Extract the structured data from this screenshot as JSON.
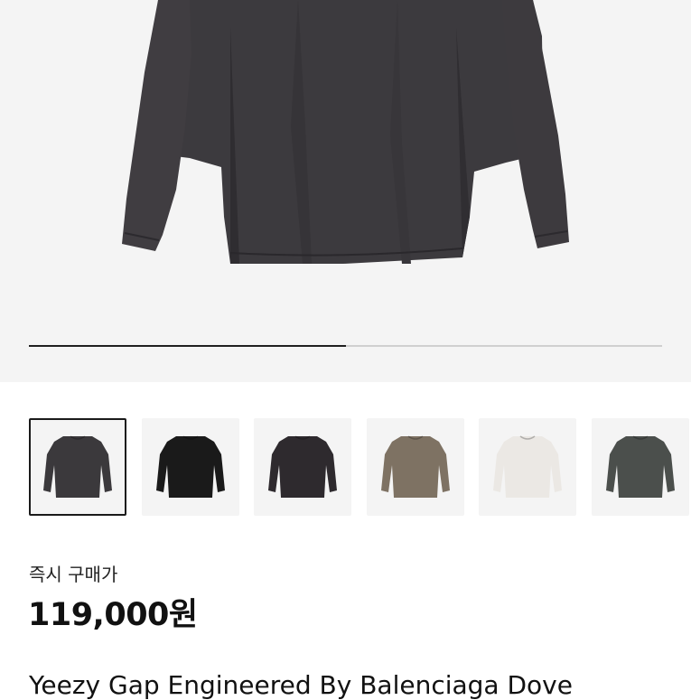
{
  "gallery": {
    "main_image": "black-long-sleeve-tshirt-photo",
    "progress_fraction": 0.5,
    "thumbnails": [
      {
        "name": "washed-black",
        "color": "#3b393c",
        "selected": true
      },
      {
        "name": "black",
        "color": "#1a1a1a",
        "selected": false
      },
      {
        "name": "dark-grey",
        "color": "#2e2a2e",
        "selected": false
      },
      {
        "name": "taupe",
        "color": "#7e7263",
        "selected": false
      },
      {
        "name": "white",
        "color": "#ebe8e4",
        "selected": false
      },
      {
        "name": "dark-green",
        "color": "#4b4f4c",
        "selected": false
      }
    ]
  },
  "purchase": {
    "label": "즉시 구매가",
    "price": "119,000원"
  },
  "product": {
    "title": "Yeezy Gap Engineered By Balenciaga Dove"
  },
  "colors": {
    "hero_bg": "#f4f4f4",
    "progress_track": "#cfcfcf",
    "progress_fill": "#1f1f1f"
  }
}
